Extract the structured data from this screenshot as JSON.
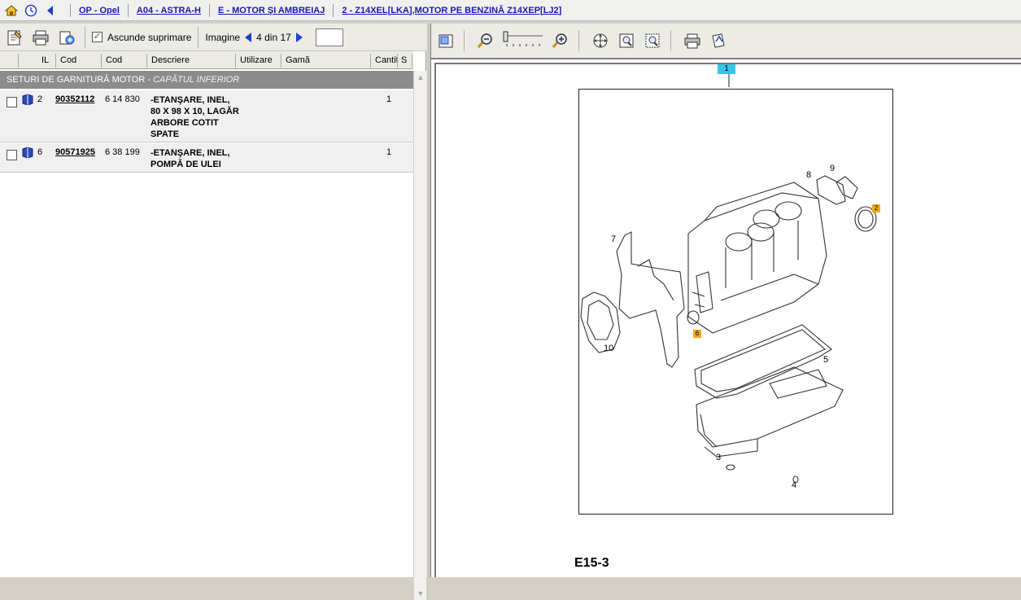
{
  "breadcrumbs": [
    "OP - Opel",
    "A04 - ASTRA-H",
    "E - MOTOR ŞI AMBREIAJ",
    "2 - Z14XEL[LKA],MOTOR PE BENZINĂ Z14XEP[LJ2]"
  ],
  "toolbar": {
    "hide_label": "Ascunde suprimare",
    "image_label": "Imagine",
    "page_indicator": "4 din 17",
    "page_input_value": ""
  },
  "columns": [
    "IL",
    "Cod",
    "Cod",
    "Descriere",
    "Utilizare",
    "Gamă",
    "Cantit",
    "S"
  ],
  "group": {
    "title": "SETURI DE GARNITURĂ MOTOR",
    "subtitle": "CAPĂTUL INFERIOR"
  },
  "parts": [
    {
      "il": "2",
      "code1": "90352112",
      "code2": "6 14 830",
      "desc": "-ETANŞARE, INEL, 80 X 98 X 10, LAGĂR ARBORE COTIT SPATE",
      "qty": "1"
    },
    {
      "il": "6",
      "code1": "90571925",
      "code2": "6 38 199",
      "desc": "-ETANŞARE, INEL, POMPĂ DE ULEI",
      "qty": "1"
    }
  ],
  "diagram": {
    "code": "E15-3",
    "top_marker": "1",
    "callouts": [
      "7",
      "8",
      "9",
      "10",
      "5",
      "3",
      "4"
    ],
    "highlighted": [
      "2",
      "6"
    ]
  },
  "colors": {
    "link": "#1a1ab0",
    "group_bg": "#8c8c8c",
    "highlight": "#f5a623",
    "marker": "#36c6ea"
  }
}
